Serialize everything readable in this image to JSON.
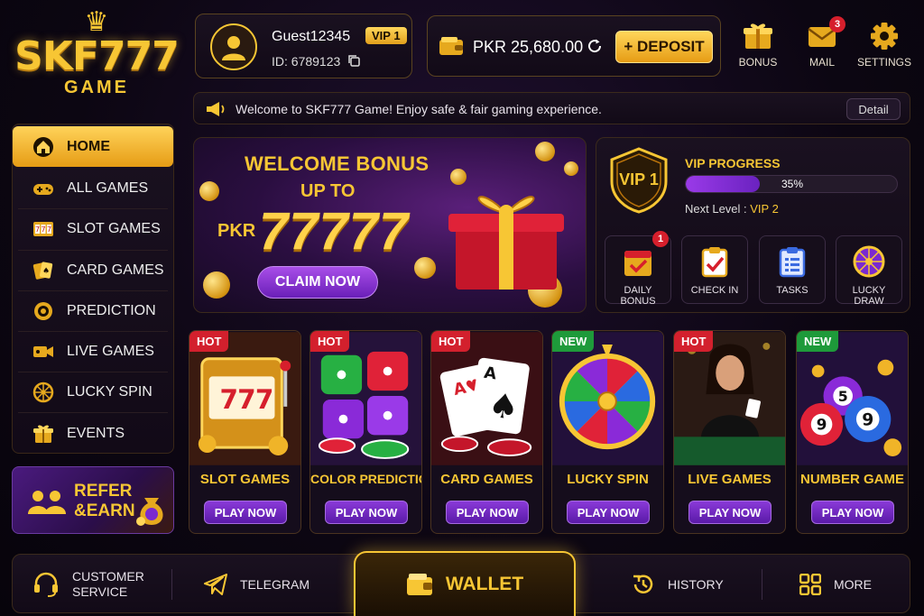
{
  "logo": {
    "brand_text": "SKF777",
    "sub_text": "GAME"
  },
  "user": {
    "name": "Guest12345",
    "vip": "VIP 1",
    "id": "ID: 6789123"
  },
  "balance": {
    "amount": "PKR 25,680.00",
    "deposit_label": "+ DEPOSIT"
  },
  "top_icons": [
    {
      "label": "BONUS",
      "icon": "gift-icon"
    },
    {
      "label": "MAIL",
      "icon": "mail-icon",
      "badge": "3"
    },
    {
      "label": "SETTINGS",
      "icon": "gear-icon"
    }
  ],
  "notice": {
    "text": "Welcome to SKF777 Game! Enjoy safe & fair gaming experience.",
    "detail_label": "Detail"
  },
  "sidebar": {
    "items": [
      {
        "label": "HOME",
        "icon": "home-icon",
        "active": true
      },
      {
        "label": "ALL GAMES",
        "icon": "gamepad-icon"
      },
      {
        "label": "SLOT GAMES",
        "icon": "slot-icon"
      },
      {
        "label": "CARD GAMES",
        "icon": "cards-icon"
      },
      {
        "label": "PREDICTION",
        "icon": "target-icon"
      },
      {
        "label": "LIVE GAMES",
        "icon": "video-icon"
      },
      {
        "label": "LUCKY SPIN",
        "icon": "wheel-icon"
      },
      {
        "label": "EVENTS",
        "icon": "gift-icon"
      }
    ]
  },
  "refer": {
    "line1": "REFER",
    "line2": "&EARN"
  },
  "welcome": {
    "title": "WELCOME BONUS",
    "upto": "UP TO",
    "currency": "PKR",
    "amount": "77777",
    "claim_label": "CLAIM NOW"
  },
  "vip_panel": {
    "badge": "VIP 1",
    "progress_label": "VIP PROGRESS",
    "progress_percent": 35,
    "progress_text": "35%",
    "next_label": "Next Level : ",
    "next_value": "VIP 2",
    "tiles": [
      {
        "label": "DAILY BONUS",
        "icon": "calendar-icon",
        "badge": "1"
      },
      {
        "label": "CHECK IN",
        "icon": "clipboard-check-icon"
      },
      {
        "label": "TASKS",
        "icon": "task-list-icon"
      },
      {
        "label": "LUCKY DRAW",
        "icon": "wheel-icon"
      }
    ]
  },
  "games": [
    {
      "title": "SLOT GAMES",
      "tag": "HOT",
      "play": "PLAY NOW"
    },
    {
      "title": "COLOR PREDICTION",
      "tag": "HOT",
      "play": "PLAY NOW"
    },
    {
      "title": "CARD GAMES",
      "tag": "HOT",
      "play": "PLAY NOW"
    },
    {
      "title": "LUCKY SPIN",
      "tag": "NEW",
      "play": "PLAY NOW"
    },
    {
      "title": "LIVE GAMES",
      "tag": "HOT",
      "play": "PLAY NOW"
    },
    {
      "title": "NUMBER GAME",
      "tag": "NEW",
      "play": "PLAY NOW"
    }
  ],
  "bottom_nav": {
    "customer_service_1": "CUSTOMER",
    "customer_service_2": "SERVICE",
    "telegram": "TELEGRAM",
    "wallet": "WALLET",
    "history": "HISTORY",
    "more": "MORE"
  },
  "colors": {
    "accent": "#f7c634",
    "purple": "#7a2ad0",
    "hot": "#d3202d",
    "new": "#1e9a3a"
  }
}
